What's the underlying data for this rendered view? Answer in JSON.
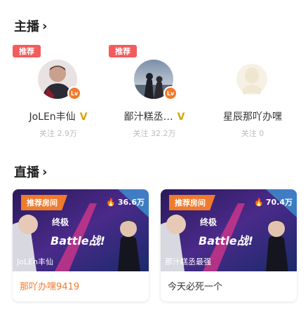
{
  "sections": {
    "streamers_title": "主播",
    "live_title": "直播",
    "chevron": "›"
  },
  "streamers": [
    {
      "badge": "推荐",
      "name": "JoLEn丰仙",
      "verified": "V",
      "followers": "关注 2.9万",
      "level": "Lv"
    },
    {
      "badge": "推荐",
      "name": "鄙汁糕丞…",
      "verified": "V",
      "followers": "关注 32.2万",
      "level": "Lv"
    },
    {
      "badge": "",
      "name": "星辰那吖办嘿",
      "verified": "",
      "followers": "关注 0",
      "level": ""
    }
  ],
  "live_rooms": [
    {
      "tag": "推荐房间",
      "viewers": "36.6万",
      "streamer": "JoLEn丰仙",
      "title": "那吖办嘿9419",
      "banner_top": "终极",
      "banner_main": "Battle战!"
    },
    {
      "tag": "推荐房间",
      "viewers": "70.4万",
      "streamer": "那汁糕丞最强",
      "title": "今天必死一个",
      "banner_top": "终极",
      "banner_main": "Battle战!"
    }
  ],
  "colors": {
    "badge": "#f25c5c",
    "tag": "#f07b2e",
    "card_title_orange": "#f07b2e",
    "card_title_dark": "#333333"
  }
}
